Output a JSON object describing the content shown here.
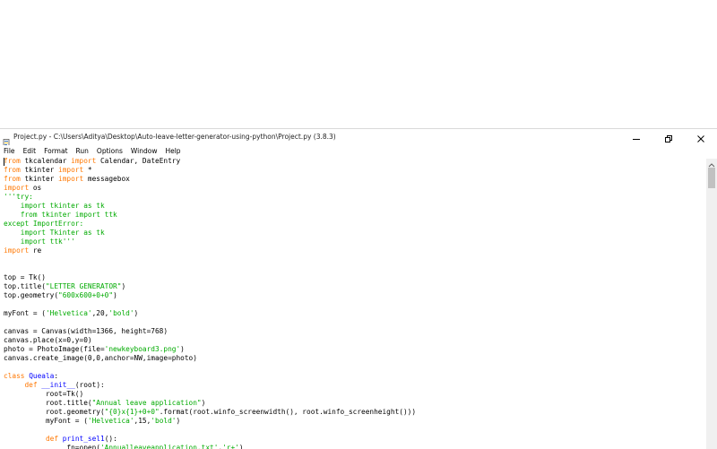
{
  "window": {
    "title": "Project.py - C:\\Users\\Aditya\\Desktop\\Auto-leave-letter-generator-using-python\\Project.py (3.8.3)",
    "icons": {
      "app": "python-file-icon",
      "minimize": "minimize-icon",
      "maximize": "restore-icon",
      "close": "close-icon"
    }
  },
  "menu": {
    "items": [
      "File",
      "Edit",
      "Format",
      "Run",
      "Options",
      "Window",
      "Help"
    ]
  },
  "colors": {
    "keyword": "#ff7700",
    "string": "#00aa00",
    "definition": "#0000ff",
    "text": "#000000"
  },
  "code": {
    "lines": [
      [
        {
          "t": "from",
          "c": "kw"
        },
        {
          "t": " tkcalendar ",
          "c": "plain"
        },
        {
          "t": "import",
          "c": "kw"
        },
        {
          "t": " Calendar, DateEntry",
          "c": "plain"
        }
      ],
      [
        {
          "t": "from",
          "c": "kw"
        },
        {
          "t": " tkinter ",
          "c": "plain"
        },
        {
          "t": "import",
          "c": "kw"
        },
        {
          "t": " *",
          "c": "plain"
        }
      ],
      [
        {
          "t": "from",
          "c": "kw"
        },
        {
          "t": " tkinter ",
          "c": "plain"
        },
        {
          "t": "import",
          "c": "kw"
        },
        {
          "t": " messagebox",
          "c": "plain"
        }
      ],
      [
        {
          "t": "import",
          "c": "kw"
        },
        {
          "t": " os",
          "c": "plain"
        }
      ],
      [
        {
          "t": "'''try:",
          "c": "str"
        }
      ],
      [
        {
          "t": "    import tkinter as tk",
          "c": "str"
        }
      ],
      [
        {
          "t": "    from tkinter import ttk",
          "c": "str"
        }
      ],
      [
        {
          "t": "except ImportError:",
          "c": "str"
        }
      ],
      [
        {
          "t": "    import Tkinter as tk",
          "c": "str"
        }
      ],
      [
        {
          "t": "    import ttk'''",
          "c": "str"
        }
      ],
      [
        {
          "t": "import",
          "c": "kw"
        },
        {
          "t": " re",
          "c": "plain"
        }
      ],
      [],
      [],
      [
        {
          "t": "top = Tk()",
          "c": "plain"
        }
      ],
      [
        {
          "t": "top.title(",
          "c": "plain"
        },
        {
          "t": "\"LETTER GENERATOR\"",
          "c": "str"
        },
        {
          "t": ")",
          "c": "plain"
        }
      ],
      [
        {
          "t": "top.geometry(",
          "c": "plain"
        },
        {
          "t": "\"600x600+0+0\"",
          "c": "str"
        },
        {
          "t": ")",
          "c": "plain"
        }
      ],
      [],
      [
        {
          "t": "myFont = (",
          "c": "plain"
        },
        {
          "t": "'Helvetica'",
          "c": "str"
        },
        {
          "t": ",20,",
          "c": "plain"
        },
        {
          "t": "'bold'",
          "c": "str"
        },
        {
          "t": ")",
          "c": "plain"
        }
      ],
      [],
      [
        {
          "t": "canvas = Canvas(width=1366, height=768)",
          "c": "plain"
        }
      ],
      [
        {
          "t": "canvas.place(x=0,y=0)",
          "c": "plain"
        }
      ],
      [
        {
          "t": "photo = PhotoImage(file=",
          "c": "plain"
        },
        {
          "t": "'newkeyboard3.png'",
          "c": "str"
        },
        {
          "t": ")",
          "c": "plain"
        }
      ],
      [
        {
          "t": "canvas.create_image(0,0,anchor=NW,image=photo)",
          "c": "plain"
        }
      ],
      [],
      [
        {
          "t": "class",
          "c": "kw"
        },
        {
          "t": " ",
          "c": "plain"
        },
        {
          "t": "Queala",
          "c": "def"
        },
        {
          "t": ":",
          "c": "plain"
        }
      ],
      [
        {
          "t": "     ",
          "c": "plain"
        },
        {
          "t": "def",
          "c": "kw"
        },
        {
          "t": " ",
          "c": "plain"
        },
        {
          "t": "__init__",
          "c": "def"
        },
        {
          "t": "(root):",
          "c": "plain"
        }
      ],
      [
        {
          "t": "          root=Tk()",
          "c": "plain"
        }
      ],
      [
        {
          "t": "          root.title(",
          "c": "plain"
        },
        {
          "t": "\"Annual leave application\"",
          "c": "str"
        },
        {
          "t": ")",
          "c": "plain"
        }
      ],
      [
        {
          "t": "          root.geometry(",
          "c": "plain"
        },
        {
          "t": "\"{0}x{1}+0+0\"",
          "c": "str"
        },
        {
          "t": ".format(root.winfo_screenwidth(), root.winfo_screenheight()))",
          "c": "plain"
        }
      ],
      [
        {
          "t": "          myFont = (",
          "c": "plain"
        },
        {
          "t": "'Helvetica'",
          "c": "str"
        },
        {
          "t": ",15,",
          "c": "plain"
        },
        {
          "t": "'bold'",
          "c": "str"
        },
        {
          "t": ")",
          "c": "plain"
        }
      ],
      [],
      [
        {
          "t": "          ",
          "c": "plain"
        },
        {
          "t": "def",
          "c": "kw"
        },
        {
          "t": " ",
          "c": "plain"
        },
        {
          "t": "print_sel1",
          "c": "def"
        },
        {
          "t": "():",
          "c": "plain"
        }
      ],
      [
        {
          "t": "               fn=open(",
          "c": "plain"
        },
        {
          "t": "'Annualleaveapplication.txt'",
          "c": "str"
        },
        {
          "t": ",",
          "c": "plain"
        },
        {
          "t": "'r+'",
          "c": "str"
        },
        {
          "t": ")",
          "c": "plain"
        }
      ]
    ]
  }
}
